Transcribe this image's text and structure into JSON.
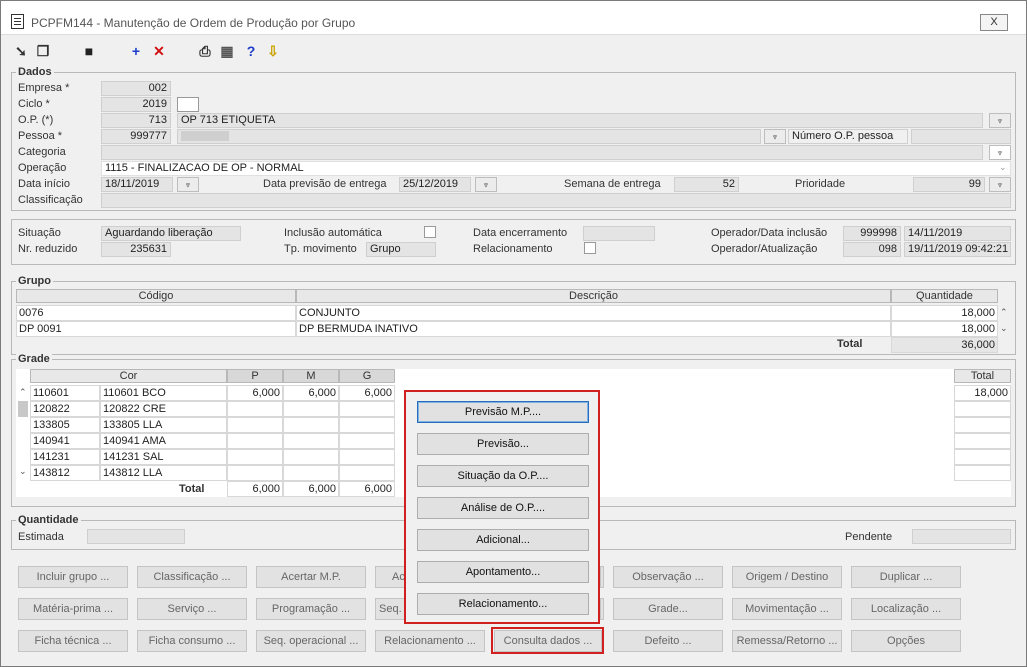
{
  "window": {
    "title": "PCPFM144 - Manutenção de Ordem de Produção por Grupo",
    "close_label": "X"
  },
  "toolbar": {
    "icons": [
      "back-icon",
      "forward-icon",
      "save-icon",
      "add-icon",
      "delete-icon",
      "print-icon",
      "calculator-icon",
      "help-icon",
      "exit-icon"
    ]
  },
  "dados": {
    "title": "Dados",
    "empresa": {
      "label": "Empresa *",
      "value": "002"
    },
    "ciclo": {
      "label": "Ciclo *",
      "value": "2019"
    },
    "op": {
      "label": "O.P. (*)",
      "value": "713",
      "desc": "OP 713 ETIQUETA"
    },
    "pessoa": {
      "label": "Pessoa *",
      "value": "999777",
      "numero_label": "Número O.P. pessoa"
    },
    "categoria": {
      "label": "Categoria"
    },
    "operacao": {
      "label": "Operação",
      "value": "1115 - FINALIZACAO DE OP - NORMAL"
    },
    "data_inicio": {
      "label": "Data início",
      "value": "18/11/2019"
    },
    "data_previsao": {
      "label": "Data previsão de entrega",
      "value": "25/12/2019"
    },
    "semana": {
      "label": "Semana de entrega",
      "value": "52"
    },
    "prioridade": {
      "label": "Prioridade",
      "value": "99"
    },
    "classificacao": {
      "label": "Classificação"
    }
  },
  "status": {
    "situacao": {
      "label": "Situação",
      "value": "Aguardando liberação"
    },
    "nr_reduzido": {
      "label": "Nr. reduzido",
      "value": "235631"
    },
    "inclusao": {
      "label": "Inclusão automática"
    },
    "tp_mov": {
      "label": "Tp. movimento",
      "value": "Grupo"
    },
    "data_enc": {
      "label": "Data encerramento"
    },
    "relacionamento": {
      "label": "Relacionamento"
    },
    "op_inclusao": {
      "label": "Operador/Data inclusão",
      "code": "999998",
      "date": "14/11/2019"
    },
    "op_atualizacao": {
      "label": "Operador/Atualização",
      "code": "098",
      "date": "19/11/2019 09:42:21"
    }
  },
  "grupo": {
    "title": "Grupo",
    "headers": {
      "codigo": "Código",
      "descricao": "Descrição",
      "quantidade": "Quantidade"
    },
    "rows": [
      {
        "codigo": "0076",
        "descricao": "CONJUNTO",
        "quantidade": "18,000"
      },
      {
        "codigo": "DP 0091",
        "descricao": "DP BERMUDA INATIVO",
        "quantidade": "18,000"
      }
    ],
    "total_label": "Total",
    "total_value": "36,000"
  },
  "grade": {
    "title": "Grade",
    "headers": {
      "cor": "Cor",
      "p": "P",
      "m": "M",
      "g": "G",
      "total": "Total"
    },
    "rows": [
      {
        "code": "110601",
        "name": "110601 BCO",
        "p": "6,000",
        "m": "6,000",
        "g": "6,000",
        "total": "18,000"
      },
      {
        "code": "120822",
        "name": "120822 CRE",
        "p": "",
        "m": "",
        "g": "",
        "total": ""
      },
      {
        "code": "133805",
        "name": "133805 LLA",
        "p": "",
        "m": "",
        "g": "",
        "total": ""
      },
      {
        "code": "140941",
        "name": "140941 AMA",
        "p": "",
        "m": "",
        "g": "",
        "total": ""
      },
      {
        "code": "141231",
        "name": "141231 SAL",
        "p": "",
        "m": "",
        "g": "",
        "total": ""
      },
      {
        "code": "143812",
        "name": "143812 LLA",
        "p": "",
        "m": "",
        "g": "",
        "total": ""
      }
    ],
    "total_label": "Total",
    "total_p": "6,000",
    "total_m": "6,000",
    "total_g": "6,000"
  },
  "quantidade": {
    "title": "Quantidade",
    "estimada_label": "Estimada",
    "pendente_label": "Pendente"
  },
  "buttons": {
    "row1": [
      "Incluir grupo ...",
      "Classificação ...",
      "Acertar M.P.",
      "Ac",
      "Observação ...",
      "Origem / Destino",
      "Duplicar ..."
    ],
    "row2": [
      "Matéria-prima ...",
      "Serviço ...",
      "Programação ...",
      "Seq.",
      "Grade...",
      "Movimentação ...",
      "Localização ..."
    ],
    "row3": [
      "Ficha técnica ...",
      "Ficha consumo ...",
      "Seq. operacional ...",
      "Relacionamento ...",
      "Consulta dados ...",
      "Defeito ...",
      "Remessa/Retorno ...",
      "Opções"
    ]
  },
  "popup": {
    "items": [
      "Previsão M.P....",
      "Previsão...",
      "Situação da O.P....",
      "Análise de O.P....",
      "Adicional...",
      "Apontamento...",
      "Relacionamento..."
    ]
  }
}
